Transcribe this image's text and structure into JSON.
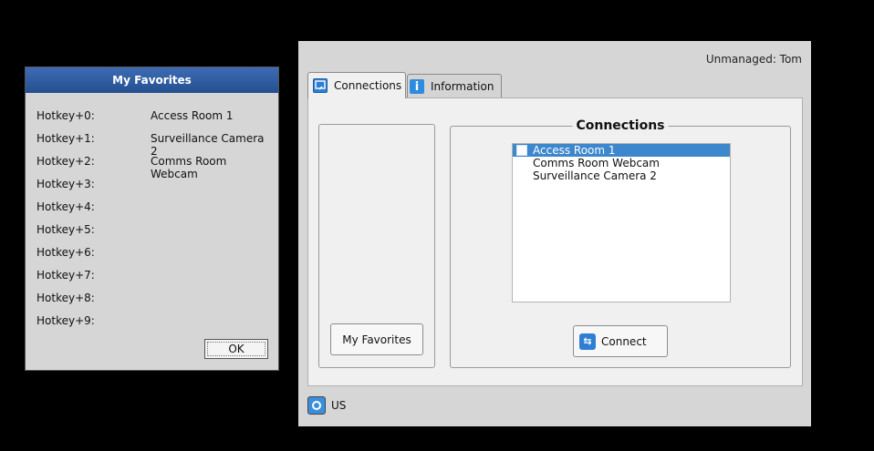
{
  "main": {
    "user_label": "Unmanaged: Tom",
    "tabs": [
      {
        "label": "Connections",
        "icon": "connections-icon",
        "active": true
      },
      {
        "label": "Information",
        "icon": "info-icon",
        "active": false
      }
    ],
    "my_favorites_button": "My Favorites",
    "connections": {
      "title": "Connections",
      "items": [
        {
          "label": "Access Room 1",
          "selected": true
        },
        {
          "label": "Comms Room Webcam",
          "selected": false
        },
        {
          "label": "Surveillance Camera 2",
          "selected": false
        }
      ],
      "connect_button": "Connect"
    },
    "status": {
      "keyboard_layout": "US"
    }
  },
  "favorites_dialog": {
    "title": "My Favorites",
    "rows": [
      {
        "key": "Hotkey+0:",
        "value": "Access Room 1"
      },
      {
        "key": "Hotkey+1:",
        "value": "Surveillance Camera 2"
      },
      {
        "key": "Hotkey+2:",
        "value": "Comms Room Webcam"
      },
      {
        "key": "Hotkey+3:",
        "value": ""
      },
      {
        "key": "Hotkey+4:",
        "value": ""
      },
      {
        "key": "Hotkey+5:",
        "value": ""
      },
      {
        "key": "Hotkey+6:",
        "value": ""
      },
      {
        "key": "Hotkey+7:",
        "value": ""
      },
      {
        "key": "Hotkey+8:",
        "value": ""
      },
      {
        "key": "Hotkey+9:",
        "value": ""
      }
    ],
    "ok_button": "OK"
  },
  "colors": {
    "accent": "#2e7fd4",
    "selection": "#3d87cc",
    "titlebar": "#2f5a9e"
  }
}
